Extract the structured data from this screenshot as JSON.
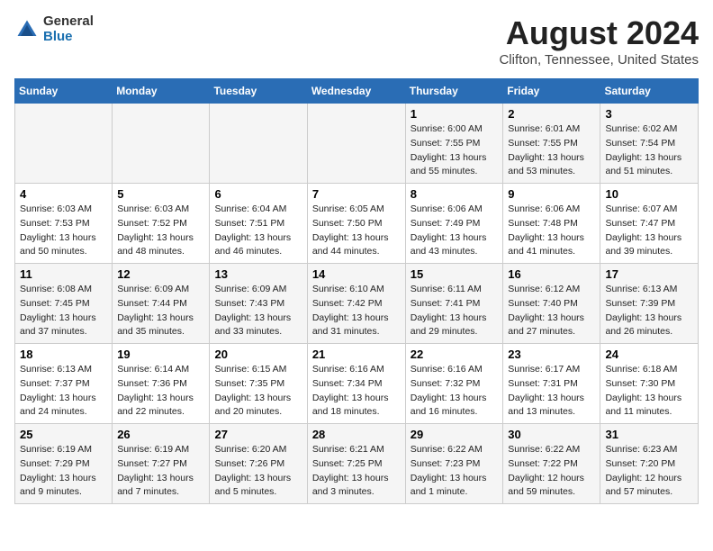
{
  "logo": {
    "general": "General",
    "blue": "Blue"
  },
  "title": "August 2024",
  "subtitle": "Clifton, Tennessee, United States",
  "days_of_week": [
    "Sunday",
    "Monday",
    "Tuesday",
    "Wednesday",
    "Thursday",
    "Friday",
    "Saturday"
  ],
  "weeks": [
    [
      {
        "day": "",
        "info": ""
      },
      {
        "day": "",
        "info": ""
      },
      {
        "day": "",
        "info": ""
      },
      {
        "day": "",
        "info": ""
      },
      {
        "day": "1",
        "info": "Sunrise: 6:00 AM\nSunset: 7:55 PM\nDaylight: 13 hours\nand 55 minutes."
      },
      {
        "day": "2",
        "info": "Sunrise: 6:01 AM\nSunset: 7:55 PM\nDaylight: 13 hours\nand 53 minutes."
      },
      {
        "day": "3",
        "info": "Sunrise: 6:02 AM\nSunset: 7:54 PM\nDaylight: 13 hours\nand 51 minutes."
      }
    ],
    [
      {
        "day": "4",
        "info": "Sunrise: 6:03 AM\nSunset: 7:53 PM\nDaylight: 13 hours\nand 50 minutes."
      },
      {
        "day": "5",
        "info": "Sunrise: 6:03 AM\nSunset: 7:52 PM\nDaylight: 13 hours\nand 48 minutes."
      },
      {
        "day": "6",
        "info": "Sunrise: 6:04 AM\nSunset: 7:51 PM\nDaylight: 13 hours\nand 46 minutes."
      },
      {
        "day": "7",
        "info": "Sunrise: 6:05 AM\nSunset: 7:50 PM\nDaylight: 13 hours\nand 44 minutes."
      },
      {
        "day": "8",
        "info": "Sunrise: 6:06 AM\nSunset: 7:49 PM\nDaylight: 13 hours\nand 43 minutes."
      },
      {
        "day": "9",
        "info": "Sunrise: 6:06 AM\nSunset: 7:48 PM\nDaylight: 13 hours\nand 41 minutes."
      },
      {
        "day": "10",
        "info": "Sunrise: 6:07 AM\nSunset: 7:47 PM\nDaylight: 13 hours\nand 39 minutes."
      }
    ],
    [
      {
        "day": "11",
        "info": "Sunrise: 6:08 AM\nSunset: 7:45 PM\nDaylight: 13 hours\nand 37 minutes."
      },
      {
        "day": "12",
        "info": "Sunrise: 6:09 AM\nSunset: 7:44 PM\nDaylight: 13 hours\nand 35 minutes."
      },
      {
        "day": "13",
        "info": "Sunrise: 6:09 AM\nSunset: 7:43 PM\nDaylight: 13 hours\nand 33 minutes."
      },
      {
        "day": "14",
        "info": "Sunrise: 6:10 AM\nSunset: 7:42 PM\nDaylight: 13 hours\nand 31 minutes."
      },
      {
        "day": "15",
        "info": "Sunrise: 6:11 AM\nSunset: 7:41 PM\nDaylight: 13 hours\nand 29 minutes."
      },
      {
        "day": "16",
        "info": "Sunrise: 6:12 AM\nSunset: 7:40 PM\nDaylight: 13 hours\nand 27 minutes."
      },
      {
        "day": "17",
        "info": "Sunrise: 6:13 AM\nSunset: 7:39 PM\nDaylight: 13 hours\nand 26 minutes."
      }
    ],
    [
      {
        "day": "18",
        "info": "Sunrise: 6:13 AM\nSunset: 7:37 PM\nDaylight: 13 hours\nand 24 minutes."
      },
      {
        "day": "19",
        "info": "Sunrise: 6:14 AM\nSunset: 7:36 PM\nDaylight: 13 hours\nand 22 minutes."
      },
      {
        "day": "20",
        "info": "Sunrise: 6:15 AM\nSunset: 7:35 PM\nDaylight: 13 hours\nand 20 minutes."
      },
      {
        "day": "21",
        "info": "Sunrise: 6:16 AM\nSunset: 7:34 PM\nDaylight: 13 hours\nand 18 minutes."
      },
      {
        "day": "22",
        "info": "Sunrise: 6:16 AM\nSunset: 7:32 PM\nDaylight: 13 hours\nand 16 minutes."
      },
      {
        "day": "23",
        "info": "Sunrise: 6:17 AM\nSunset: 7:31 PM\nDaylight: 13 hours\nand 13 minutes."
      },
      {
        "day": "24",
        "info": "Sunrise: 6:18 AM\nSunset: 7:30 PM\nDaylight: 13 hours\nand 11 minutes."
      }
    ],
    [
      {
        "day": "25",
        "info": "Sunrise: 6:19 AM\nSunset: 7:29 PM\nDaylight: 13 hours\nand 9 minutes."
      },
      {
        "day": "26",
        "info": "Sunrise: 6:19 AM\nSunset: 7:27 PM\nDaylight: 13 hours\nand 7 minutes."
      },
      {
        "day": "27",
        "info": "Sunrise: 6:20 AM\nSunset: 7:26 PM\nDaylight: 13 hours\nand 5 minutes."
      },
      {
        "day": "28",
        "info": "Sunrise: 6:21 AM\nSunset: 7:25 PM\nDaylight: 13 hours\nand 3 minutes."
      },
      {
        "day": "29",
        "info": "Sunrise: 6:22 AM\nSunset: 7:23 PM\nDaylight: 13 hours\nand 1 minute."
      },
      {
        "day": "30",
        "info": "Sunrise: 6:22 AM\nSunset: 7:22 PM\nDaylight: 12 hours\nand 59 minutes."
      },
      {
        "day": "31",
        "info": "Sunrise: 6:23 AM\nSunset: 7:20 PM\nDaylight: 12 hours\nand 57 minutes."
      }
    ]
  ]
}
